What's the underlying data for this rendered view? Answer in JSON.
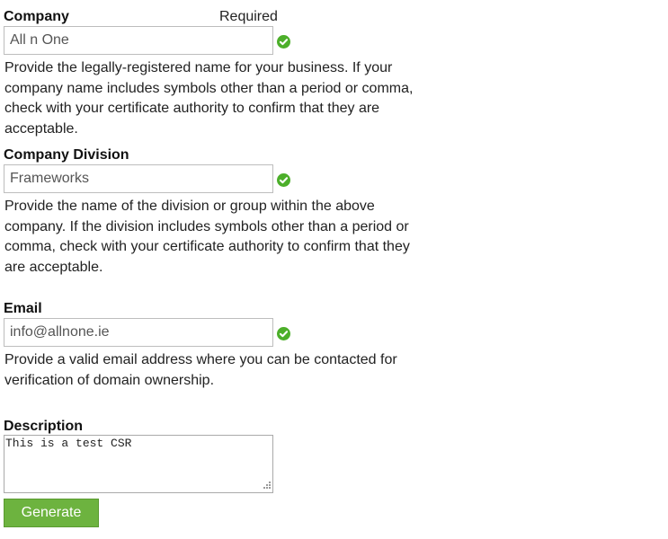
{
  "colors": {
    "valid_icon": "#4caf2a",
    "button_bg": "#6db33f",
    "button_text": "#ffffff"
  },
  "form": {
    "required_label": "Required",
    "company": {
      "label": "Company",
      "value": "All n One",
      "valid_icon": "check-circle-icon",
      "help": "Provide the legally-registered name for your business. If your company name includes symbols other than a period or comma, check with your certificate authority to confirm that they are acceptable."
    },
    "division": {
      "label": "Company Division",
      "value": "Frameworks",
      "valid_icon": "check-circle-icon",
      "help": "Provide the name of the division or group within the above company. If the division includes symbols other than a period or comma, check with your certificate authority to confirm that they are acceptable."
    },
    "email": {
      "label": "Email",
      "value": "info@allnone.ie",
      "valid_icon": "check-circle-icon",
      "help": "Provide a valid email address where you can be contacted for verification of domain ownership."
    },
    "description": {
      "label": "Description",
      "value": "This is a test CSR"
    },
    "generate_label": "Generate"
  }
}
